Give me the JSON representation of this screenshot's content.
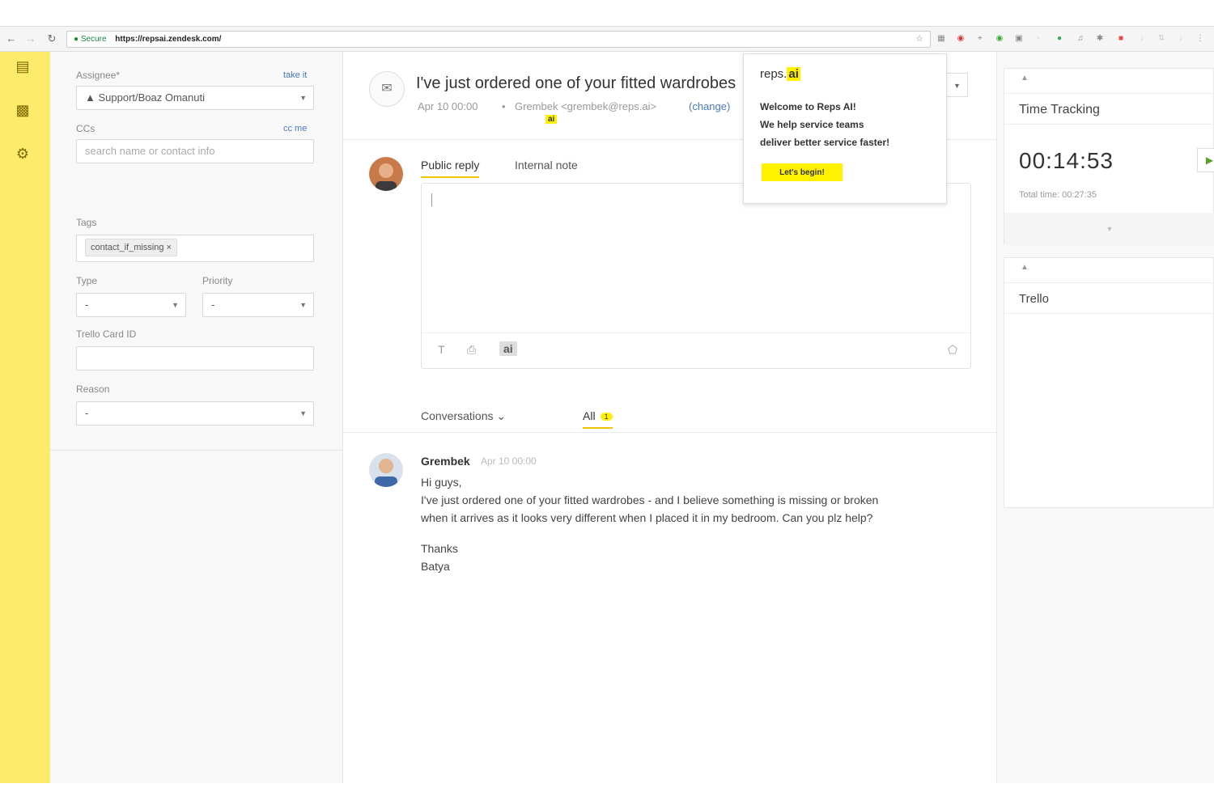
{
  "browser": {
    "secure_label": "Secure",
    "url": "https://repsai.zendesk.com/"
  },
  "properties": {
    "assignee_label": "Assignee*",
    "take_it": "take it",
    "assignee_value": "Support/Boaz Omanuti",
    "ccs_label": "CCs",
    "cc_me": "cc me",
    "ccs_placeholder": "search name or contact info",
    "tags_label": "Tags",
    "tag_value": "contact_if_missing ×",
    "type_label": "Type",
    "type_value": "-",
    "priority_label": "Priority",
    "priority_value": "-",
    "trello_label": "Trello Card ID",
    "reason_label": "Reason",
    "reason_value": "-"
  },
  "ticket": {
    "subject": "I've just ordered one of your fitted wardrobes",
    "date": "Apr 10 00:00",
    "sender": "Grembek <grembek@reps.ai>",
    "change": "(change)",
    "ai_badge": "ai"
  },
  "reply": {
    "tab_public": "Public reply",
    "tab_internal": "Internal note",
    "tool_text": "T",
    "tool_attach": "⎙",
    "tool_ai": "ai",
    "tool_tag": "⬠"
  },
  "conversations": {
    "filter_label": "Conversations ⌄",
    "all_label": "All",
    "all_count": "1"
  },
  "message": {
    "author": "Grembek",
    "time": "Apr 10 00:00",
    "line1": "Hi guys,",
    "line2": "I've just ordered one of your fitted wardrobes - and I believe something is missing or broken",
    "line3": "when it arrives as it looks very different when I placed it in my bedroom. Can you plz help?",
    "line4": "Thanks",
    "line5": "Batya"
  },
  "popup": {
    "brand_prefix": "reps.",
    "brand_suffix": "ai",
    "line1": "Welcome to Reps AI!",
    "line2": "We help service teams",
    "line3": "deliver better service faster!",
    "button": "Let's begin!"
  },
  "right": {
    "time_tracking_title": "Time Tracking",
    "timer": "00:14:53",
    "total_time": "Total time: 00:27:35",
    "trello_title": "Trello"
  },
  "colors": {
    "accent_yellow": "#fdec6b",
    "highlight_yellow": "#fff100",
    "link_blue": "#4a78c2"
  }
}
